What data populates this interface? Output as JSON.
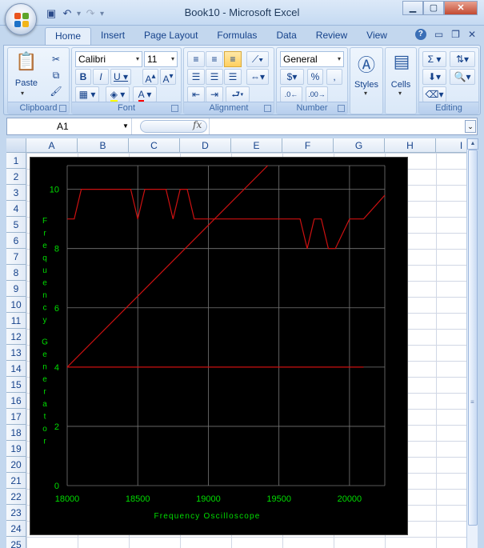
{
  "window": {
    "title": "Book10 - Microsoft Excel"
  },
  "ribbon": {
    "tabs": [
      "Home",
      "Insert",
      "Page Layout",
      "Formulas",
      "Data",
      "Review",
      "View"
    ],
    "clipboard": {
      "label": "Clipboard",
      "paste": "Paste"
    },
    "font": {
      "label": "Font",
      "name": "Calibri",
      "size": "11"
    },
    "alignment": {
      "label": "Alignment"
    },
    "number": {
      "label": "Number",
      "format": "General"
    },
    "styles": {
      "label": "Styles"
    },
    "cells": {
      "label": "Cells"
    },
    "editing": {
      "label": "Editing"
    }
  },
  "formula_bar": {
    "name_box": "A1",
    "fx": "fx",
    "value": ""
  },
  "sheet": {
    "columns": [
      "A",
      "B",
      "C",
      "D",
      "E",
      "F",
      "G",
      "H",
      "I"
    ],
    "rows": [
      "1",
      "2",
      "3",
      "4",
      "5",
      "6",
      "7",
      "8",
      "9",
      "10",
      "11",
      "12",
      "13",
      "14",
      "15",
      "16",
      "17",
      "18",
      "19",
      "20",
      "21",
      "22",
      "23",
      "24",
      "25"
    ]
  },
  "chart_data": {
    "type": "line",
    "xlabel": "Frequency Oscilloscope",
    "ylabel": "Frequency Generator",
    "xlim": [
      18000,
      20250
    ],
    "ylim": [
      0,
      10.8
    ],
    "xticks": [
      18000,
      18500,
      19000,
      19500,
      20000
    ],
    "yticks": [
      0,
      2,
      4,
      6,
      8,
      10
    ],
    "grid": true,
    "background": "#000000",
    "axis_text_color": "#00dd00",
    "line_color": "#cc1111",
    "series": [
      {
        "x": [
          18000,
          18050,
          18100,
          18450,
          18500,
          18550,
          18700,
          18750,
          18800,
          18850,
          18900,
          19650,
          19700,
          19750,
          19800,
          19850,
          19900,
          20000,
          20100,
          20250
        ],
        "y": [
          9,
          9,
          10,
          10,
          9,
          10,
          10,
          9,
          10,
          10,
          9,
          9,
          8,
          9,
          9,
          8,
          8,
          9,
          9,
          9.8
        ]
      },
      {
        "x": [
          18000,
          19420
        ],
        "y": [
          4,
          10.8
        ]
      },
      {
        "x": [
          18000,
          20100
        ],
        "y": [
          4,
          4
        ]
      }
    ]
  }
}
